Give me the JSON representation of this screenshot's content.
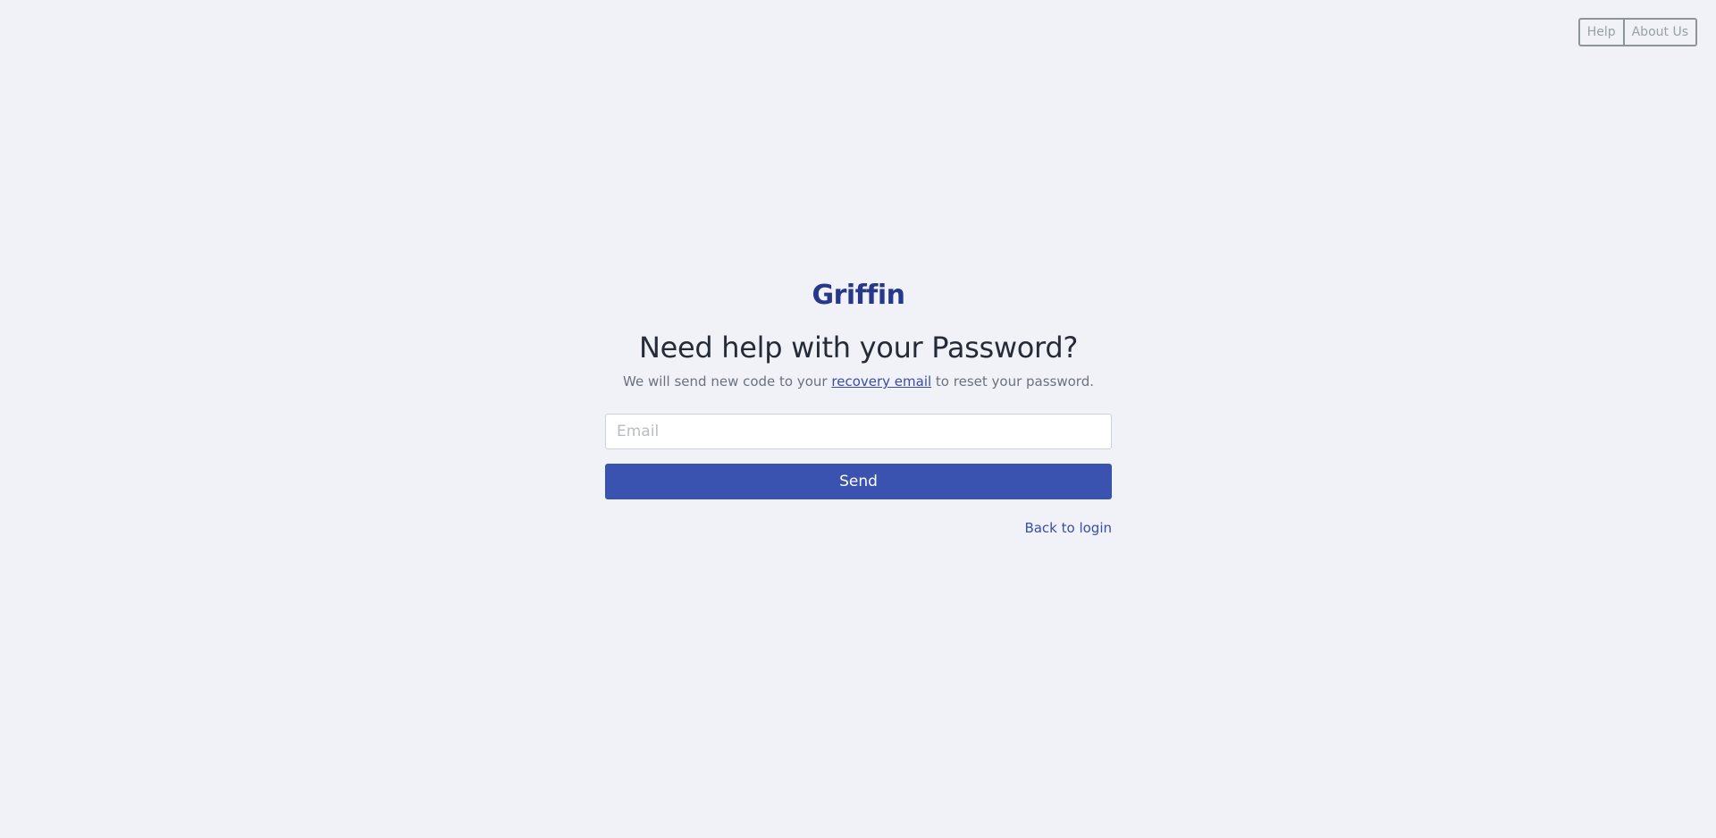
{
  "topnav": {
    "help_label": "Help",
    "about_label": "About Us"
  },
  "brand": {
    "logo_text": "Griffin",
    "color": "#27388c"
  },
  "main": {
    "heading": "Need help with your Password?",
    "subtext_before": "We will send new code to your ",
    "subtext_link": "recovery email",
    "subtext_after": " to reset your password.",
    "email_placeholder": "Email",
    "email_value": "",
    "send_label": "Send",
    "send_color": "#3a53b0",
    "back_label": "Back to login"
  }
}
